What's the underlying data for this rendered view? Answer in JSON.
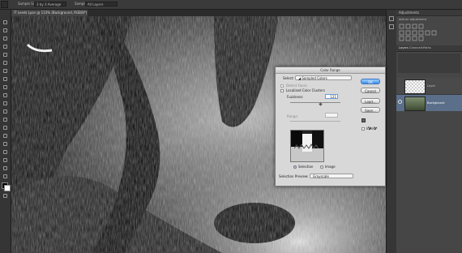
{
  "options_bar": {
    "sample_size_label": "Sample Size:",
    "sample_size_value": "3 by 3 Average",
    "sample_label": "Sample:",
    "sample_value": "All Layers"
  },
  "document_tab": {
    "label": "IT Leeds Lyon @ 133% (Background, RGB/8*)"
  },
  "right_panel": {
    "adjustments_tab": "Adjustments",
    "add_adjustment": "Add an adjustment",
    "layers_tab": "Layers",
    "channels_tab": "Channels",
    "paths_tab": "Paths",
    "layers": [
      {
        "name": "Layer",
        "selected": false
      },
      {
        "name": "Background",
        "selected": true
      }
    ]
  },
  "color_range": {
    "title": "Color Range",
    "select_label": "Select:",
    "select_value": "Sampled Colors",
    "detect_faces": "Detect Faces",
    "localized_clusters": "Localized Color Clusters",
    "fuzziness_label": "Fuzziness:",
    "fuzziness_value": "121",
    "fuzziness_fraction": 0.6,
    "range_label": "Range:",
    "range_value": "",
    "selection_label": "Selection",
    "image_label": "Image",
    "selection_preview_label": "Selection Preview:",
    "selection_preview_value": "Grayscale",
    "ok": "OK",
    "cancel": "Cancel",
    "load": "Load...",
    "save": "Save...",
    "invert": "Invert",
    "colors": {
      "ok_blue": "#3d8fe5"
    }
  }
}
